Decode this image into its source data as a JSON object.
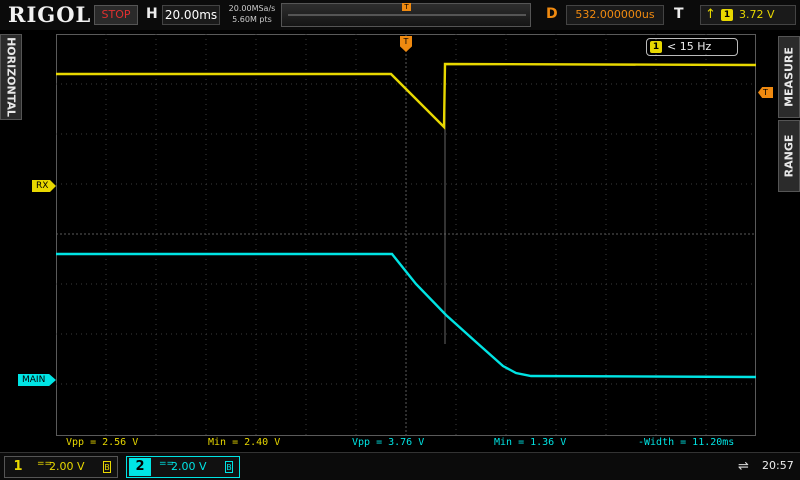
{
  "header": {
    "logo": "RIGOL",
    "run_status": "STOP",
    "horizontal_label": "H",
    "timebase": "20.00ms",
    "sample_rate": "20.00MSa/s",
    "memory_depth": "5.60M pts",
    "trigger_position_glyph": "T",
    "delay_label": "D",
    "delay": "532.000000us",
    "trigger_label": "T",
    "trigger_edge_icon": "rising-edge-icon",
    "trigger_source": "1",
    "trigger_level": "3.72 V"
  },
  "side_tabs": {
    "left": "HORIZONTAL",
    "right_top": "MEASURE",
    "right_bottom": "RANGE"
  },
  "markers": {
    "ch1_label": "RX",
    "ch2_label": "MAIN",
    "trigger_glyph": "T"
  },
  "frequency": {
    "source": "1",
    "value": "< 15 Hz"
  },
  "measurements": [
    {
      "text": "Vpp = 2.56 V",
      "channel": "1"
    },
    {
      "text": "Min = 2.40 V",
      "channel": "1"
    },
    {
      "text": "Vpp = 3.76 V",
      "channel": "2"
    },
    {
      "text": "Min = 1.36 V",
      "channel": "2"
    },
    {
      "text": "-Width = 11.20ms",
      "channel": "2"
    }
  ],
  "channels": [
    {
      "number": "1",
      "coupling": "==",
      "scale": "2.00 V",
      "bw": "B",
      "color": "#e8d800"
    },
    {
      "number": "2",
      "coupling": "==",
      "scale": "2.00 V",
      "bw": "B",
      "color": "#00e4e4"
    }
  ],
  "status_bar": {
    "usb_icon": "usb-icon",
    "usb_glyph": "⇌",
    "time": "20:57"
  },
  "colors": {
    "ch1": "#e8d800",
    "ch2": "#00e4e4",
    "trigger": "#f08a10",
    "stop": "#e03030"
  }
}
